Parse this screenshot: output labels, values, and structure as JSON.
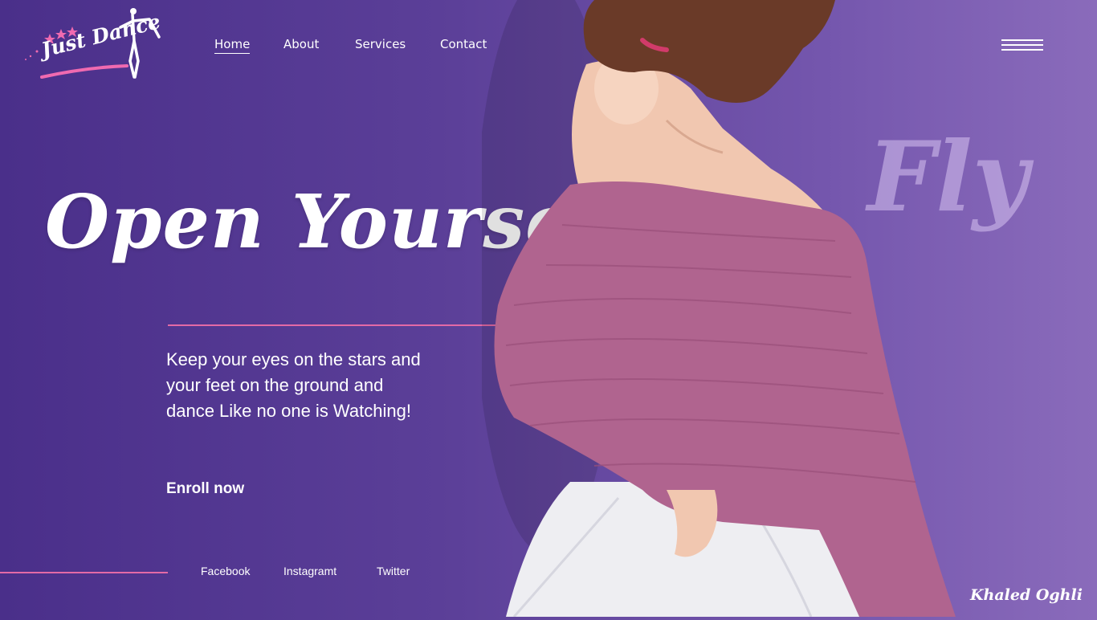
{
  "brand": {
    "logo_text": "Just Dance"
  },
  "nav": {
    "items": [
      {
        "label": "Home",
        "active": true
      },
      {
        "label": "About",
        "active": false
      },
      {
        "label": "Services",
        "active": false
      },
      {
        "label": "Contact",
        "active": false
      }
    ]
  },
  "menu_icon": "hamburger-menu-icon",
  "hero": {
    "headline": "Open Yourself",
    "accent_word": "Fly",
    "tagline": "Keep your eyes on the stars and your feet on the ground and dance Like no one is Watching!",
    "cta_label": "Enroll now"
  },
  "social": [
    {
      "label": "Facebook"
    },
    {
      "label": "Instagramt"
    },
    {
      "label": "Twitter"
    }
  ],
  "signature": "Khaled Oghli",
  "colors": {
    "background_start": "#4a2f8a",
    "background_end": "#8a6bbb",
    "accent_pink": "#e36aa6",
    "sweater": "#b0648f",
    "skirt": "#eeeef2"
  }
}
